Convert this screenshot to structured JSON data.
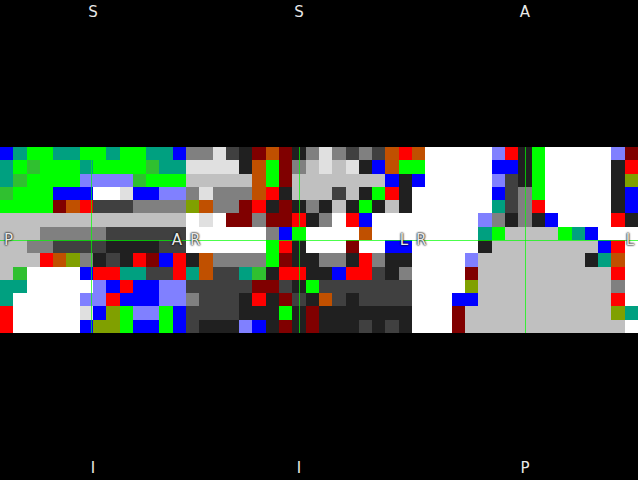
{
  "palette": {
    "0": "#000000",
    "1": "#ffffff",
    "2": "#c0c0c0",
    "3": "#808080",
    "4": "#404040",
    "5": "#00ff00",
    "6": "#00a080",
    "7": "#0000ff",
    "8": "#ff0000",
    "9": "#800000",
    "a": "#c05000",
    "b": "#8080ff",
    "c": "#80a000",
    "d": "#e0e0e0",
    "e": "#202020",
    "f": "#30c030"
  },
  "views": [
    {
      "name": "sagittal",
      "top": "S",
      "bottom": "I",
      "left": "P",
      "right": "A",
      "crosshair": {
        "x": 0.49,
        "y": 0.5
      },
      "voxels": [
        "76556655655667",
        "65f55565555f66",
        "6f5555bbbbf555",
        "f55577711d77bb",
        "55559a84443333",
        "22222222222222",
        "22233333444444",
        "22334444eeee44",
        "2228ac3e4e8978",
        "2f111178866448",
        "6611111b7877bb",
        "611111bb8777bb",
        "811111d7c5bb57",
        "8111117cc57757"
      ]
    },
    {
      "name": "coronal",
      "top": "S",
      "bottom": "I",
      "left": "R",
      "right": "L",
      "crosshair": {
        "x": 0.5,
        "y": 0.5
      },
      "voxels": [
        "33d4e9a9e3d3434a8",
        "ddddea5932d2de7a5",
        "22222a5922222227e",
        "3d333a8e22242e58e",
        "ca3398e9e3e2e5e2e",
        "1d1993998e3187111",
        "1111113751111a111",
        "11111158e11191177",
        "ea333359ee33e83ee",
        "6a446fe88ee7884e3",
        "44444994e54444444",
        "3444e8e94ea4e4444",
        "4444eee5e9eeeeeee",
        "4eeeb7e9e9eee4e4e"
      ]
    },
    {
      "name": "axial",
      "top": "A",
      "bottom": "P",
      "left": "R",
      "right": "L",
      "crosshair": {
        "x": 0.5,
        "y": 0.5
      },
      "voxels": [
        "a11111b8e511111b9",
        "51111177e511111e8",
        "711111b4e511111ec",
        "111111743511111e7",
        "111111643811111e7",
        "11111b3e3e711118e",
        "11111652222567111",
        "11111e22222222781",
        "1111b22222222e6a1",
        "11119222222222281",
        "1111c222222222231",
        "11177222222222281",
        "111922222222222c6",
        "11192222222222221"
      ]
    }
  ]
}
